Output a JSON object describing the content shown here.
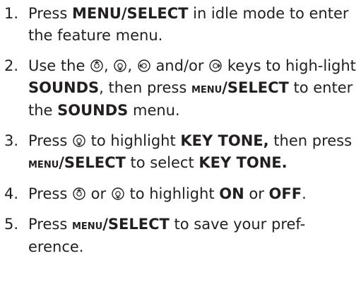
{
  "steps": [
    {
      "number": "1.",
      "parts": {
        "t1": "Press ",
        "menu_label": "MENU/SELECT",
        "t2": " in idle mode to enter the feature menu."
      }
    },
    {
      "number": "2.",
      "parts": {
        "t1": "Use the ",
        "sep1": ", ",
        "sep2": ", ",
        "t2": " and/or ",
        "t3": " keys to high-light ",
        "sounds1": "SOUNDS",
        "t4": ", then press ",
        "menu_prefix": "MENU",
        "menu_suffix": "/SELECT",
        "t5": " to enter the ",
        "sounds2": "SOUNDS",
        "t6": " menu."
      }
    },
    {
      "number": "3.",
      "parts": {
        "t1": "Press ",
        "t2": " to highlight ",
        "key_tone1": "KEY TONE,",
        "t3": " then press ",
        "menu_prefix": "MENU",
        "menu_suffix": "/SELECT",
        "t4": " to select ",
        "key_tone2": "KEY TONE."
      }
    },
    {
      "number": "4.",
      "parts": {
        "t1": "Press ",
        "t2": " or ",
        "t3": " to highlight ",
        "on": "ON",
        "t4": " or ",
        "off": "OFF",
        "t5": "."
      }
    },
    {
      "number": "5.",
      "parts": {
        "t1": "Press ",
        "menu_prefix": "MENU",
        "menu_suffix": "/SELECT",
        "t2": " to save your pref-erence."
      }
    }
  ],
  "icons": {
    "up_key": "up-key-icon",
    "down_key": "down-key-icon",
    "left_key": "left-key-icon",
    "right_key": "right-key-icon"
  },
  "colors": {
    "text": "#231f20"
  }
}
